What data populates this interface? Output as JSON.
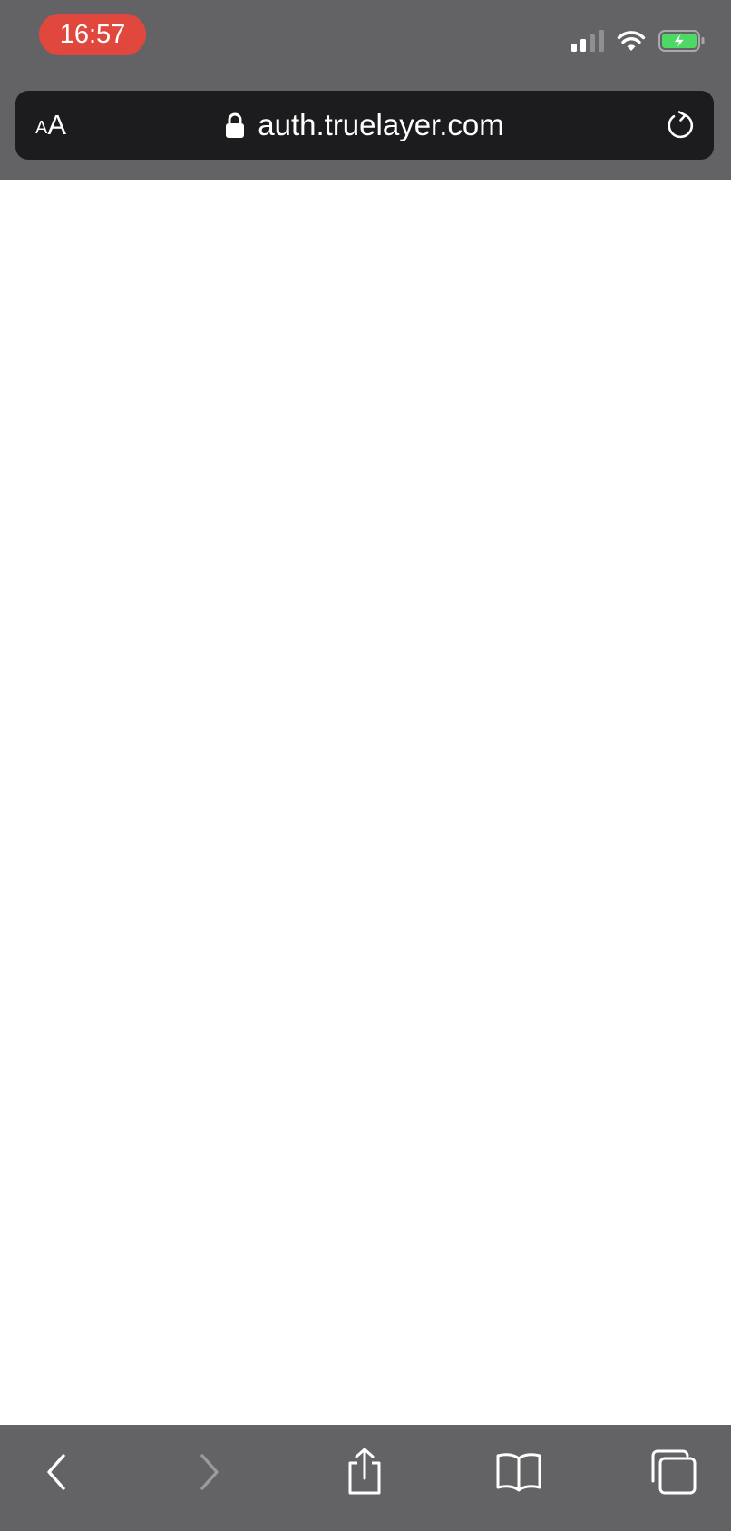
{
  "status_bar": {
    "time": "16:57",
    "icons": [
      "signal-icon",
      "wifi-icon",
      "battery-charging-icon"
    ]
  },
  "url_bar": {
    "text_size_small": "A",
    "text_size_large": "A",
    "url": "auth.truelayer.com",
    "icons": [
      "lock-icon",
      "reload-icon"
    ]
  },
  "toolbar": {
    "buttons": [
      "back-icon",
      "forward-icon",
      "share-icon",
      "bookmarks-icon",
      "tabs-icon"
    ]
  },
  "colors": {
    "chrome": "#636366",
    "url_bar": "#1c1c1e",
    "time_pill": "#e0483e",
    "battery_charge": "#4cd964",
    "page": "#ffffff"
  }
}
